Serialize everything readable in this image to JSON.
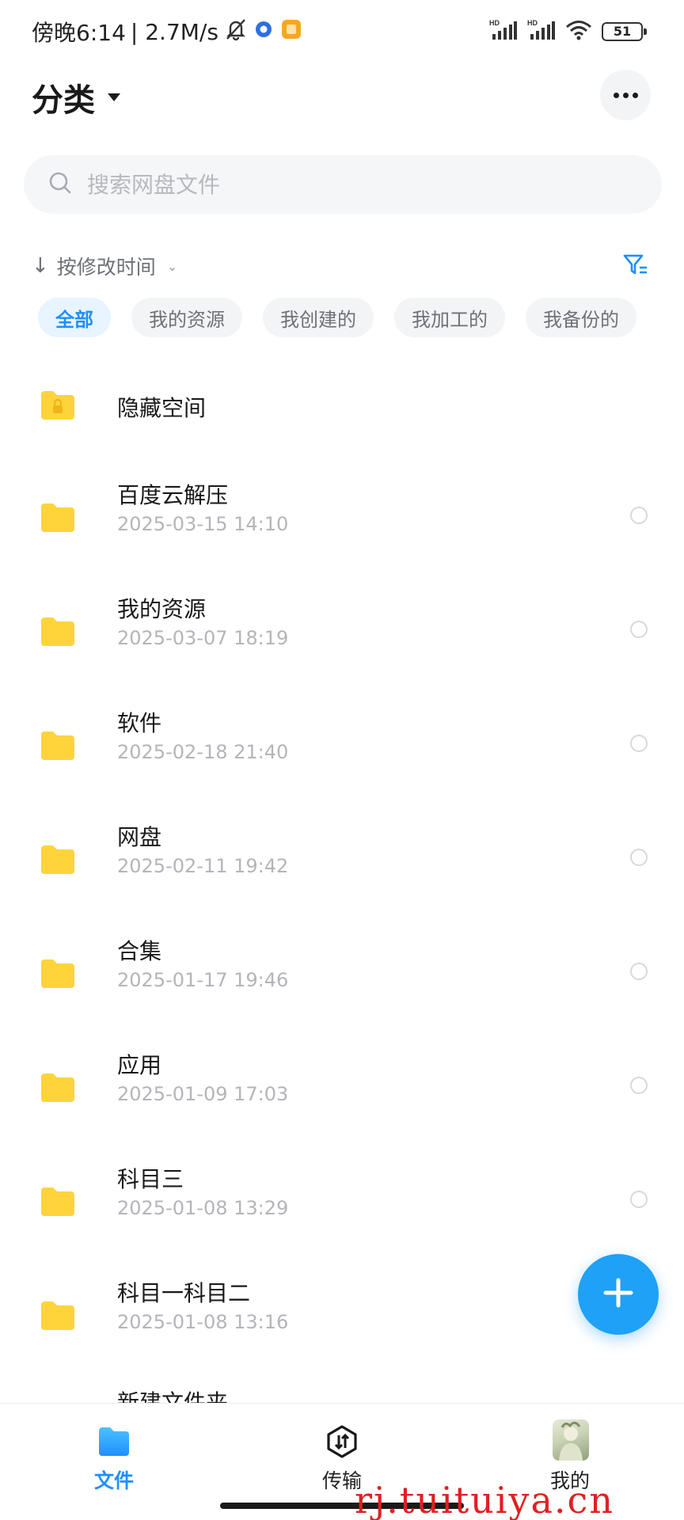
{
  "status_bar": {
    "time": "傍晚6:14",
    "speed": "| 2.7M/s",
    "battery": "51",
    "network_labels": [
      "HD",
      "HD"
    ],
    "icons": [
      "mute-bell-icon",
      "app-notification-icon",
      "gallery-notification-icon",
      "signal-icon",
      "signal-icon",
      "wifi-icon",
      "battery-icon"
    ]
  },
  "header": {
    "title": "分类",
    "more_icon": "more-dots-icon"
  },
  "search": {
    "placeholder": "搜索网盘文件",
    "icon": "search-icon"
  },
  "sort": {
    "label": "按修改时间",
    "arrow": "↓",
    "caret": "⌄"
  },
  "filter_icon": "filter-icon",
  "chips": [
    {
      "label": "全部",
      "active": true
    },
    {
      "label": "我的资源",
      "active": false
    },
    {
      "label": "我创建的",
      "active": false
    },
    {
      "label": "我加工的",
      "active": false
    },
    {
      "label": "我备份的",
      "active": false
    }
  ],
  "files": [
    {
      "name": "隐藏空间",
      "date": "",
      "locked": true
    },
    {
      "name": "百度云解压",
      "date": "2025-03-15  14:10"
    },
    {
      "name": "我的资源",
      "date": "2025-03-07  18:19"
    },
    {
      "name": "软件",
      "date": "2025-02-18  21:40"
    },
    {
      "name": "网盘",
      "date": "2025-02-11  19:42"
    },
    {
      "name": "合集",
      "date": "2025-01-17  19:46"
    },
    {
      "name": "应用",
      "date": "2025-01-09  17:03"
    },
    {
      "name": "科目三",
      "date": "2025-01-08  13:29"
    },
    {
      "name": "科目一科目二",
      "date": "2025-01-08  13:16"
    },
    {
      "name": "新建文件夹",
      "date": ""
    }
  ],
  "fab": {
    "icon": "plus-icon"
  },
  "bottom_nav": [
    {
      "label": "文件",
      "icon": "folder-icon",
      "active": true
    },
    {
      "label": "传输",
      "icon": "transfer-icon",
      "active": false
    },
    {
      "label": "我的",
      "icon": "avatar",
      "active": false
    }
  ],
  "colors": {
    "accent": "#1e8fff",
    "folder": "#ffd43b",
    "fab": "#1ea1f7"
  },
  "watermark": "rj.tuituiya.cn"
}
